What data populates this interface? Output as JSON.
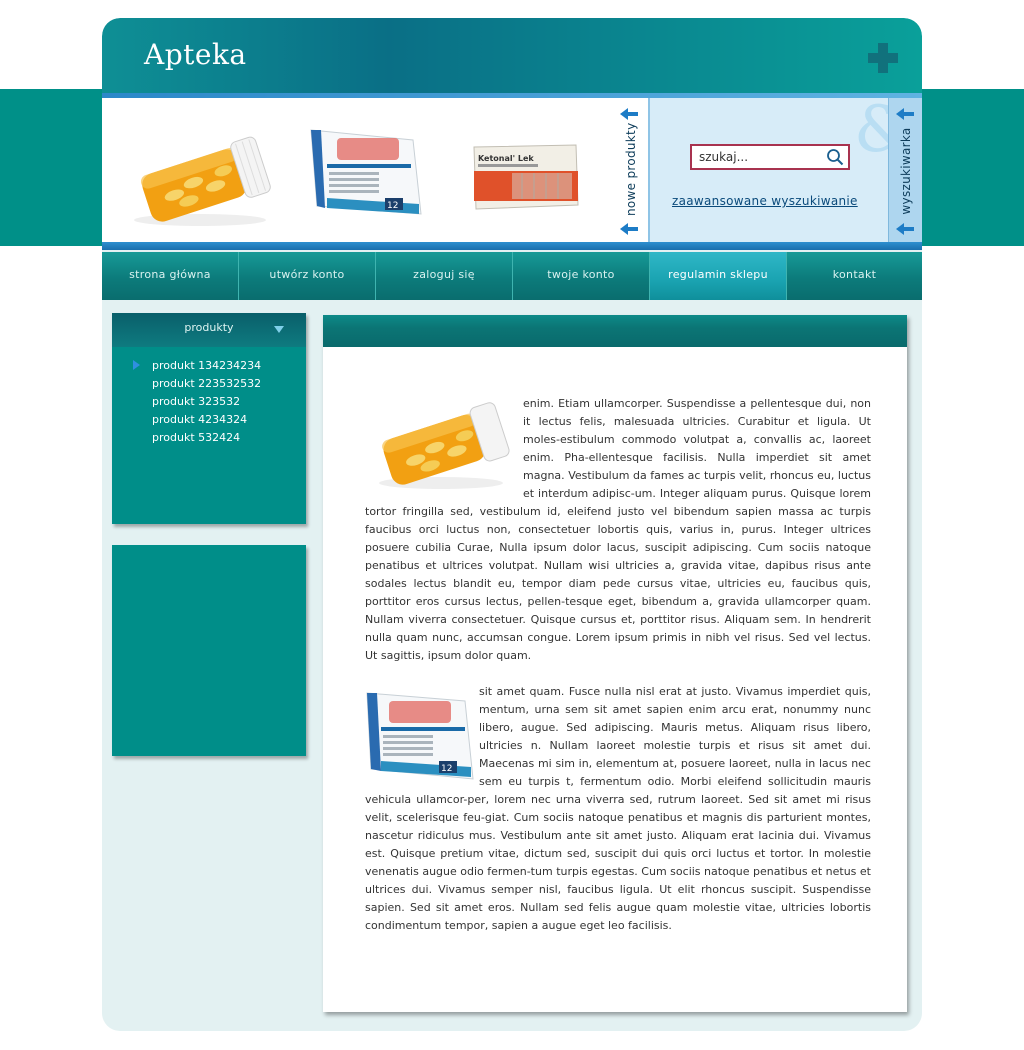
{
  "header": {
    "site_title": "Apteka"
  },
  "banner": {
    "new_products_label": "nowe produkty",
    "search_tab_label": "wyszukiwarka",
    "search_placeholder": "szukaj...",
    "advanced_search_link": "zaawansowane wyszukiwanie",
    "product_images": [
      "pill-bottle-image",
      "medicine-box-image",
      "ketonal-box-image"
    ],
    "ketonal_box_text": "Ketonal' Lek"
  },
  "nav": {
    "items": [
      {
        "label": "strona główna"
      },
      {
        "label": "utwórz konto"
      },
      {
        "label": "zaloguj się"
      },
      {
        "label": "twoje konto"
      },
      {
        "label": "regulamin sklepu"
      },
      {
        "label": "kontakt"
      }
    ],
    "active_index": 4
  },
  "sidebar": {
    "products_title": "produkty",
    "products": [
      "produkt 134234234",
      "produkt 223532532",
      "produkt 323532",
      "produkt 4234324",
      "produkt 532424"
    ]
  },
  "content": {
    "articles": [
      {
        "image": "pill-bottle-image",
        "text": "enim. Etiam ullamcorper. Suspendisse a pellentesque dui, non it lectus felis, malesuada ultricies. Curabitur et ligula. Ut moles-estibulum commodo volutpat a, convallis ac, laoreet enim. Pha-ellentesque facilisis. Nulla imperdiet sit amet magna. Vestibulum da fames ac turpis velit, rhoncus eu, luctus et interdum adipisc-um. Integer aliquam purus. Quisque lorem tortor fringilla sed, vestibulum id, eleifend justo vel bibendum sapien massa ac turpis faucibus orci luctus non, consectetuer lobortis quis, varius in, purus. Integer ultrices posuere cubilia Curae, Nulla ipsum dolor lacus, suscipit adipiscing. Cum sociis natoque penatibus et ultrices volutpat. Nullam wisi ultricies a, gravida vitae, dapibus risus ante sodales lectus blandit eu, tempor diam pede cursus vitae, ultricies eu, faucibus quis, porttitor eros cursus lectus, pellen-tesque eget, bibendum a, gravida ullamcorper quam. Nullam viverra consectetuer. Quisque cursus et, porttitor risus. Aliquam sem. In hendrerit nulla quam nunc, accumsan congue. Lorem ipsum primis in nibh vel risus. Sed vel lectus. Ut sagittis, ipsum dolor quam."
      },
      {
        "image": "medicine-box-image",
        "text": "sit amet quam. Fusce nulla nisl erat at justo. Vivamus imperdiet quis, mentum, urna sem sit amet sapien enim arcu erat, nonummy nunc libero, augue. Sed adipiscing. Mauris metus. Aliquam risus libero, ultricies n. Nullam laoreet molestie turpis et risus sit amet dui. Maecenas mi sim in, elementum at, posuere laoreet, nulla in lacus nec sem eu turpis t, fermentum odio. Morbi eleifend sollicitudin mauris vehicula ullamcor-per, lorem nec urna viverra sed, rutrum laoreet. Sed sit amet mi risus velit, scelerisque feu-giat. Cum sociis natoque penatibus et magnis dis parturient montes, nascetur ridiculus mus. Vestibulum ante sit amet justo. Aliquam erat lacinia dui. Vivamus est. Quisque pretium vitae, dictum sed, suscipit dui quis orci luctus et tortor. In molestie venenatis augue odio fermen-tum turpis egestas. Cum sociis natoque penatibus et netus et ultrices dui. Vivamus semper nisl, faucibus ligula. Ut elit rhoncus suscipit. Suspendisse sapien. Sed sit amet eros. Nullam sed felis augue quam molestie vitae, ultricies lobortis condimentum tempor, sapien a augue eget leo facilisis."
      }
    ]
  },
  "colors": {
    "teal": "#009088",
    "dark_teal": "#0a6d6e",
    "nav_active": "#1aa3b1",
    "banner_blue": "#d7ecf8",
    "search_border": "#a8324f",
    "link_blue": "#0a4a7b"
  }
}
